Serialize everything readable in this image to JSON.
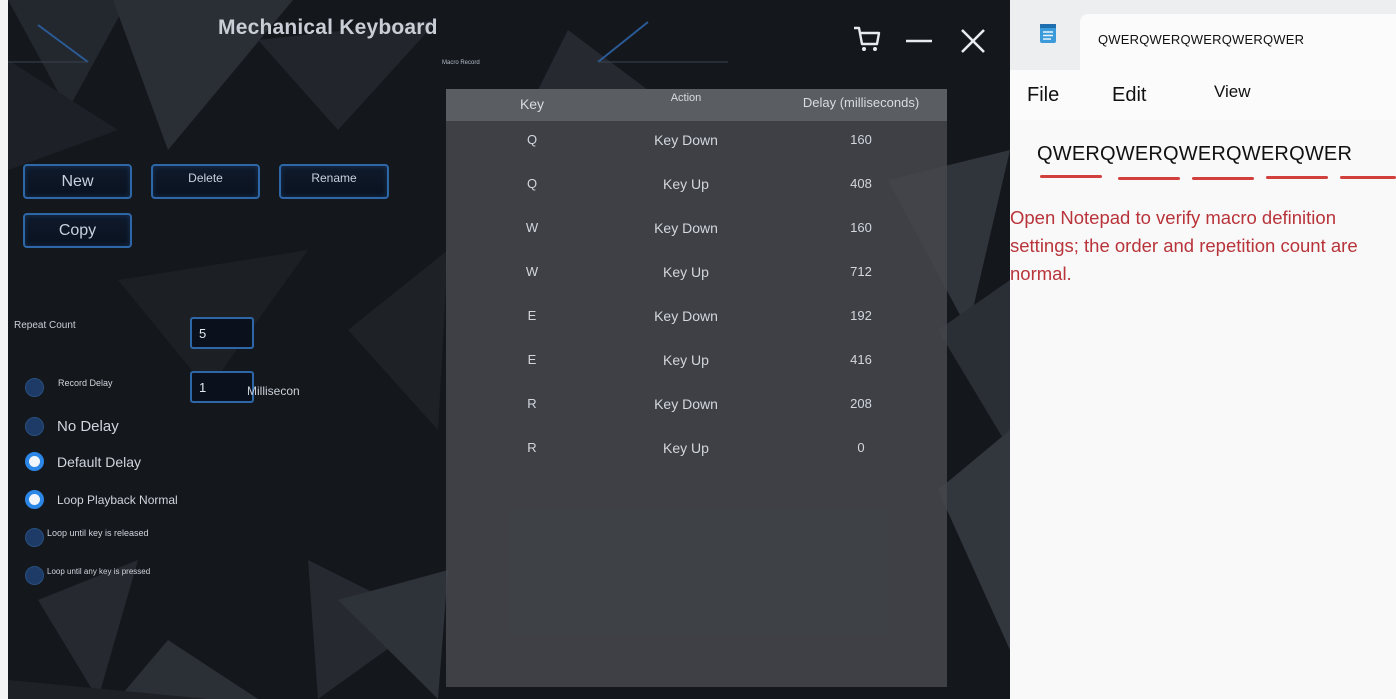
{
  "keyboard_app": {
    "title": "Mechanical Keyboard",
    "buttons": {
      "new": "New",
      "delete": "Delete",
      "rename": "Rename",
      "copy": "Copy"
    },
    "repeat_count_label": "Repeat Count",
    "repeat_count_value": "5",
    "record_delay_label": "Record Delay",
    "record_delay_value": "1",
    "record_delay_unit": "Millisecon",
    "delay_options": [
      {
        "label": "No Delay",
        "selected": false
      },
      {
        "label": "Default Delay",
        "selected": true
      }
    ],
    "loop_options": [
      {
        "label": "Loop Playback Normal",
        "selected": true
      },
      {
        "label": "Loop until key is released",
        "selected": false
      },
      {
        "label": "Loop until any key is pressed",
        "selected": false
      }
    ],
    "macro_record_caption": "Macro Record",
    "table": {
      "headers": {
        "key": "Key",
        "action": "Action",
        "delay": "Delay (milliseconds)"
      },
      "rows": [
        {
          "key": "Q",
          "action": "Key Down",
          "delay": "160"
        },
        {
          "key": "Q",
          "action": "Key Up",
          "delay": "408"
        },
        {
          "key": "W",
          "action": "Key Down",
          "delay": "160"
        },
        {
          "key": "W",
          "action": "Key Up",
          "delay": "712"
        },
        {
          "key": "E",
          "action": "Key Down",
          "delay": "192"
        },
        {
          "key": "E",
          "action": "Key Up",
          "delay": "416"
        },
        {
          "key": "R",
          "action": "Key Down",
          "delay": "208"
        },
        {
          "key": "R",
          "action": "Key Up",
          "delay": "0"
        }
      ]
    },
    "icons": [
      "cart-icon",
      "minimize-icon",
      "close-icon"
    ],
    "colors": {
      "accent": "#2e67a8",
      "radio_selected": "#2c86e6",
      "background": "#14171c"
    }
  },
  "notepad": {
    "tab_title": "QWERQWERQWERQWERQWER",
    "menu": [
      "File",
      "Edit",
      "View"
    ],
    "content": "QWERQWERQWERQWERQWER",
    "annotation": "Open Notepad to verify macro definition settings; the order and repetition count are normal.",
    "colors": {
      "annotation": "#b8343a",
      "spell_underline": "#d2403e"
    }
  }
}
